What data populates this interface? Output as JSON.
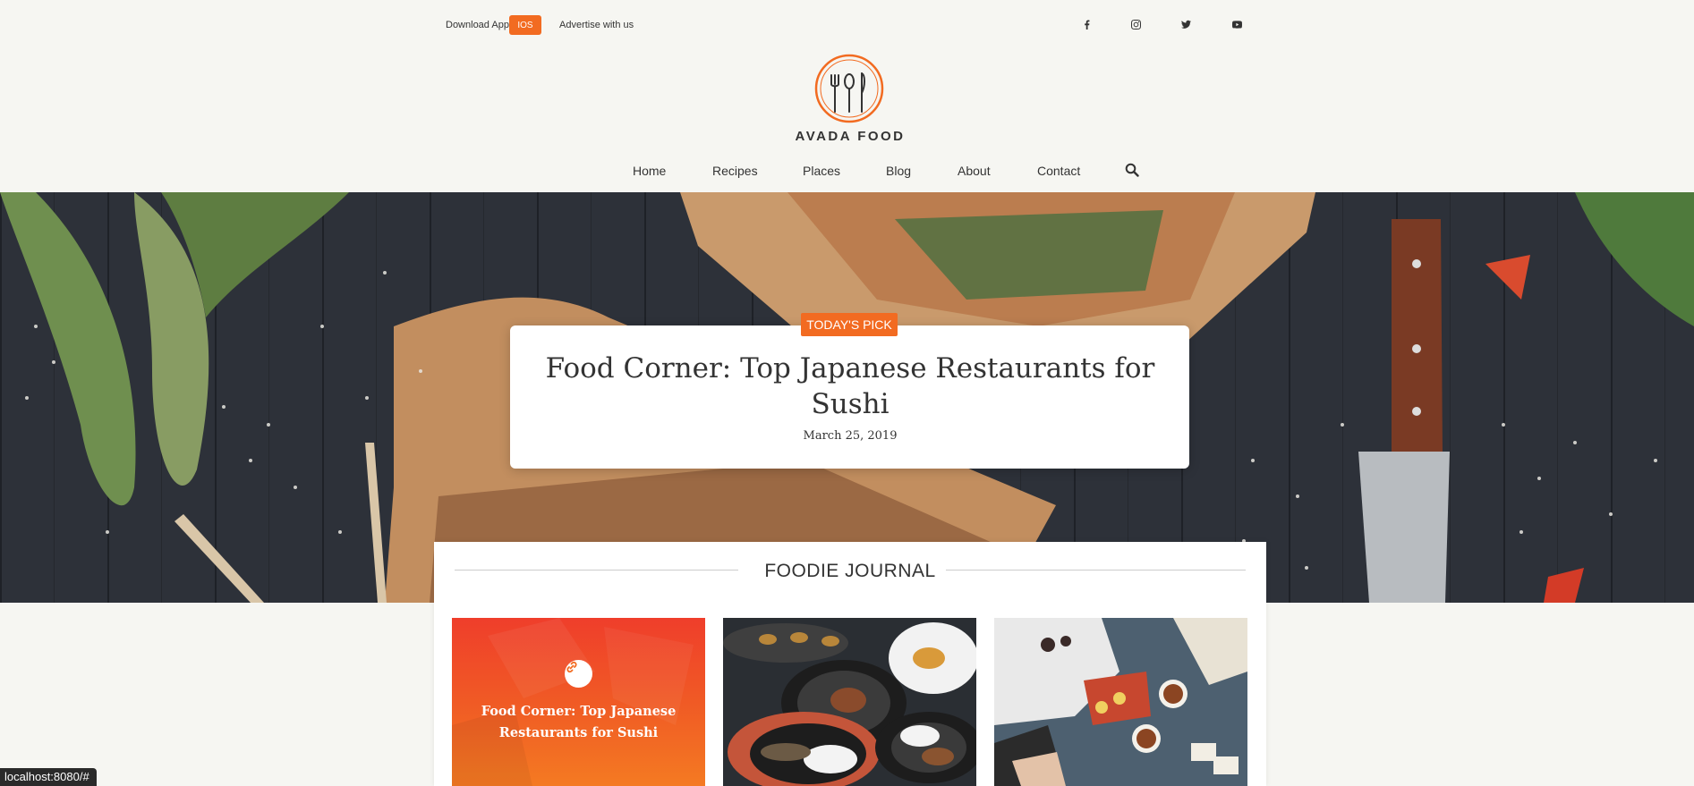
{
  "topbar": {
    "download_label": "Download App",
    "ios_label": "IOS",
    "advertise_label": "Advertise with us",
    "social": [
      "facebook-icon",
      "instagram-icon",
      "twitter-icon",
      "youtube-icon"
    ]
  },
  "logo": {
    "text": "AVADA FOOD",
    "accent": "#f26b21"
  },
  "nav": {
    "items": [
      "Home",
      "Recipes",
      "Places",
      "Blog",
      "About",
      "Contact"
    ],
    "search_icon": "search-icon"
  },
  "hero": {
    "badge": "TODAY'S PICK",
    "title": "Food Corner: Top Japanese Restaurants for Sushi",
    "date": "March 25, 2019"
  },
  "journal": {
    "heading": "FOODIE JOURNAL",
    "cards": [
      {
        "title": "Food Corner: Top Japanese Restaurants for Sushi",
        "icon": "link-icon"
      },
      {
        "title": "",
        "icon": ""
      },
      {
        "title": "",
        "icon": ""
      }
    ]
  },
  "status": {
    "url": "localhost:8080/#"
  },
  "colors": {
    "accent": "#f26b21",
    "background": "#f6f6f2",
    "text": "#333333"
  }
}
